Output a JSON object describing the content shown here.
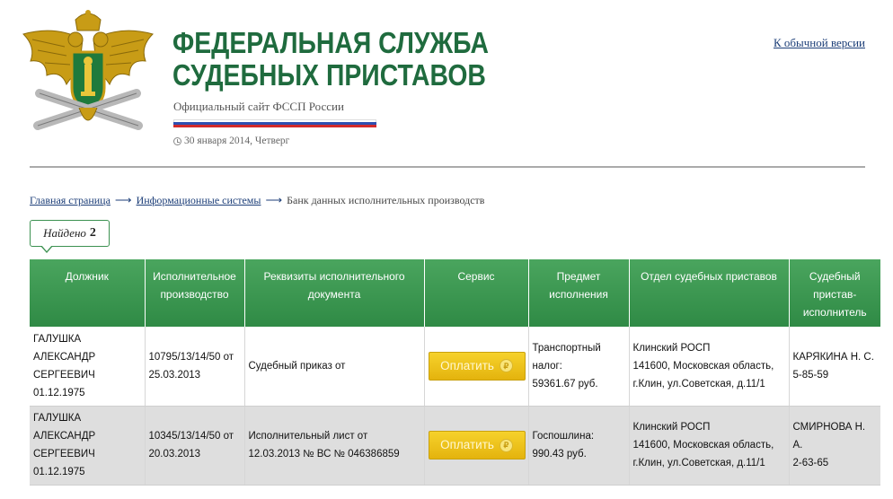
{
  "header": {
    "title_line1": "ФЕДЕРАЛЬНАЯ СЛУЖБА",
    "title_line2": "СУДЕБНЫХ ПРИСТАВОВ",
    "subtitle": "Официальный сайт ФССП России",
    "date": "30 января 2014, Четверг",
    "regular_version_link": "К обычной версии"
  },
  "breadcrumb": {
    "home": "Главная страница",
    "systems": "Информационные системы",
    "current": "Банк данных исполнительных производств",
    "separator": "⟶"
  },
  "results": {
    "found_label": "Найдено",
    "found_count": "2",
    "columns": [
      "Должник",
      "Исполнительное производство",
      "Реквизиты исполнительного документа",
      "Сервис",
      "Предмет исполнения",
      "Отдел судебных приставов",
      "Судебный пристав-исполнитель"
    ],
    "pay_label": "Оплатить",
    "rows": [
      {
        "debtor_name": "ГАЛУШКА АЛЕКСАНДР СЕРГЕЕВИЧ",
        "debtor_birth": "01.12.1975",
        "proceeding": "10795/13/14/50 от 25.03.2013",
        "document": "Судебный приказ от",
        "subject_type": "Транспортный налог:",
        "subject_amount": "59361.67 руб.",
        "department_name": "Клинский РОСП",
        "department_address": "141600, Московская область, г.Клин, ул.Советская, д.11/1",
        "bailiff_name": "КАРЯКИНА Н. С.",
        "bailiff_phone": "5-85-59"
      },
      {
        "debtor_name": "ГАЛУШКА АЛЕКСАНДР СЕРГЕЕВИЧ",
        "debtor_birth": "01.12.1975",
        "proceeding": "10345/13/14/50 от 20.03.2013",
        "document": "Исполнительный лист от 12.03.2013 № ВС № 046386859",
        "subject_type": "Госпошлина:",
        "subject_amount": "990.43 руб.",
        "department_name": "Клинский РОСП",
        "department_address": "141600, Московская область, г.Клин, ул.Советская, д.11/1",
        "bailiff_name": "СМИРНОВА Н. А.",
        "bailiff_phone": "2-63-65"
      }
    ]
  },
  "colors": {
    "brand_green": "#1f6b3e",
    "header_green": "#3c9151",
    "pay_yellow": "#f2c41d",
    "link_blue": "#1c3e78",
    "row_alt": "#dedede"
  },
  "icons": {
    "emblem": "fssp-double-headed-eagle-emblem",
    "date": "clock-icon",
    "currency": "ruble-icon"
  }
}
